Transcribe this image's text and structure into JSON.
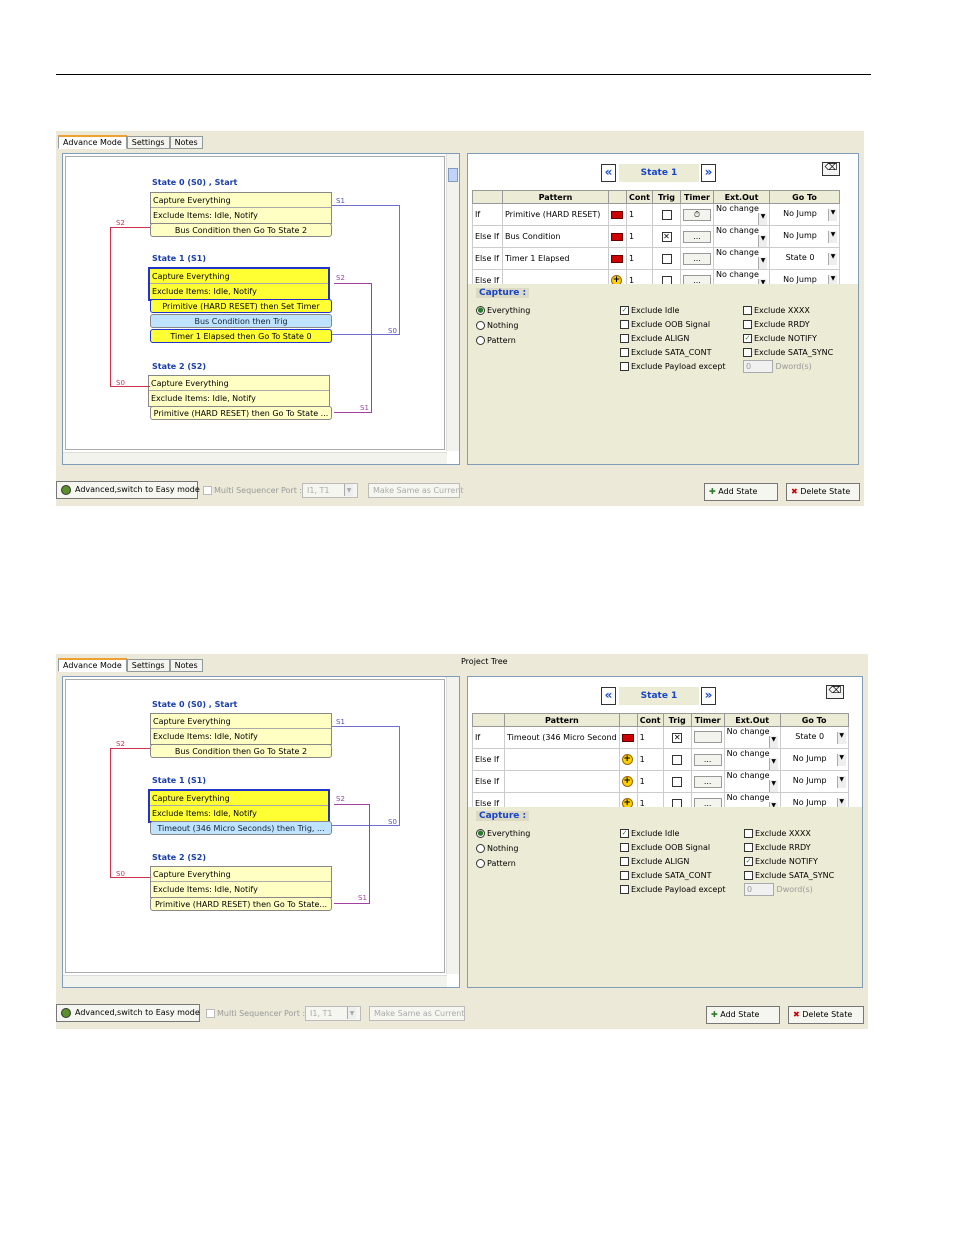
{
  "tabs": [
    "Advance Mode",
    "Settings",
    "Notes"
  ],
  "project_tree_label": "Project Tree",
  "states": [
    {
      "title": "State 0 (S0) , Start",
      "rows": [
        "Capture Everything",
        "Exclude Items: Idle, Notify"
      ]
    },
    {
      "title": "State 1 (S1)",
      "rows": [
        "Capture Everything",
        "Exclude Items: Idle, Notify"
      ]
    },
    {
      "title": "State 2 (S2)",
      "rows": [
        "Capture Everything",
        "Exclude Items: Idle, Notify"
      ]
    }
  ],
  "panel1": {
    "s0_conds": [
      "Bus Condition then Go To State 2"
    ],
    "s1_conds": [
      "Primitive (HARD RESET) then Set Timer",
      "Bus Condition then Trig",
      "Timer 1 Elapsed then Go To State 0"
    ],
    "s2_conds": [
      "Primitive (HARD RESET) then Go To State ..."
    ],
    "rows": [
      {
        "kind": "If",
        "pattern": "Primitive (HARD RESET)",
        "cont": "1",
        "trig": "",
        "timer": "⏱",
        "ext": "No change",
        "goto": "No Jump"
      },
      {
        "kind": "Else If",
        "pattern": "Bus Condition",
        "cont": "1",
        "trig": "✕",
        "timer": "...",
        "ext": "No change",
        "goto": "No Jump"
      },
      {
        "kind": "Else If",
        "pattern": "Timer 1 Elapsed",
        "cont": "1",
        "trig": "",
        "timer": "...",
        "ext": "No change",
        "goto": "State 0"
      },
      {
        "kind": "Else If",
        "pattern": "",
        "cont": "1",
        "trig": "",
        "timer": "...",
        "ext": "No change",
        "goto": "No Jump"
      }
    ]
  },
  "panel2": {
    "s0_conds": [
      "Bus Condition then Go To State 2"
    ],
    "s1_conds": [
      "Timeout (346 Micro Seconds) then Trig, ..."
    ],
    "s2_conds": [
      "Primitive (HARD RESET) then Go To State..."
    ],
    "rows": [
      {
        "kind": "If",
        "pattern": "Timeout (346 Micro Second",
        "cont": "1",
        "trig": "✕",
        "timer": "",
        "ext": "No change",
        "goto": "State 0"
      },
      {
        "kind": "Else If",
        "pattern": "",
        "cont": "1",
        "trig": "",
        "timer": "...",
        "ext": "No change",
        "goto": "No Jump"
      },
      {
        "kind": "Else If",
        "pattern": "",
        "cont": "1",
        "trig": "",
        "timer": "...",
        "ext": "No change",
        "goto": "No Jump"
      },
      {
        "kind": "Else If",
        "pattern": "",
        "cont": "1",
        "trig": "",
        "timer": "...",
        "ext": "No change",
        "goto": "No Jump"
      }
    ]
  },
  "arrow_labels": {
    "s1": "S1",
    "s2": "S2",
    "s0": "S0"
  },
  "nav": {
    "prev": "«",
    "next": "»",
    "state": "State 1",
    "eraser": "⌫"
  },
  "grid_headers": [
    "",
    "Pattern",
    "",
    "Cont",
    "Trig",
    "Timer",
    "Ext.Out",
    "Go To"
  ],
  "capture": {
    "header": "Capture :",
    "radios": [
      "Everything",
      "Nothing",
      "Pattern"
    ],
    "col1": [
      "Exclude Idle",
      "Exclude OOB Signal",
      "Exclude ALIGN",
      "Exclude SATA_CONT",
      "Exclude Payload except"
    ],
    "col2": [
      "Exclude XXXX",
      "Exclude RRDY",
      "Exclude NOTIFY",
      "Exclude SATA_SYNC"
    ],
    "dword_value": "0",
    "dword_label": "Dword(s)"
  },
  "bottom": {
    "easy_mode": "Advanced,switch to Easy mode",
    "multi_seq": "Multi Sequencer",
    "port_label": "Port :",
    "port_value": "I1, T1",
    "make_same": "Make Same as Current",
    "add_state": "Add State",
    "delete_state": "Delete State"
  }
}
